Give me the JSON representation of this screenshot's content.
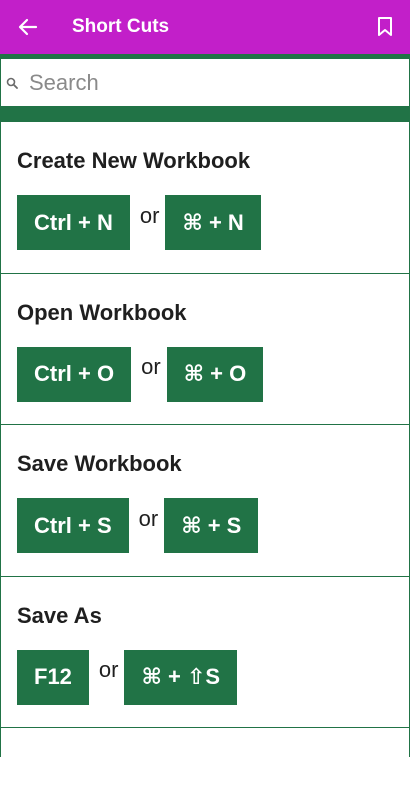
{
  "appbar": {
    "title": "Short Cuts",
    "back_icon": "arrow-left-icon",
    "bookmark_icon": "bookmark-icon",
    "color": "#c21fc9"
  },
  "search": {
    "placeholder": "Search",
    "icon": "search-icon"
  },
  "theme": {
    "key_color": "#217346"
  },
  "shortcuts": [
    {
      "title": "Create New Workbook",
      "win": "Ctrl + N",
      "or": "or",
      "mac": "⌘ + N"
    },
    {
      "title": "Open Workbook",
      "win": "Ctrl + O",
      "or": "or",
      "mac": "⌘ + O"
    },
    {
      "title": "Save Workbook",
      "win": "Ctrl + S",
      "or": "or",
      "mac": "⌘ + S"
    },
    {
      "title": "Save As",
      "win": "F12",
      "or": "or",
      "mac": "⌘ + ⇧S"
    }
  ]
}
